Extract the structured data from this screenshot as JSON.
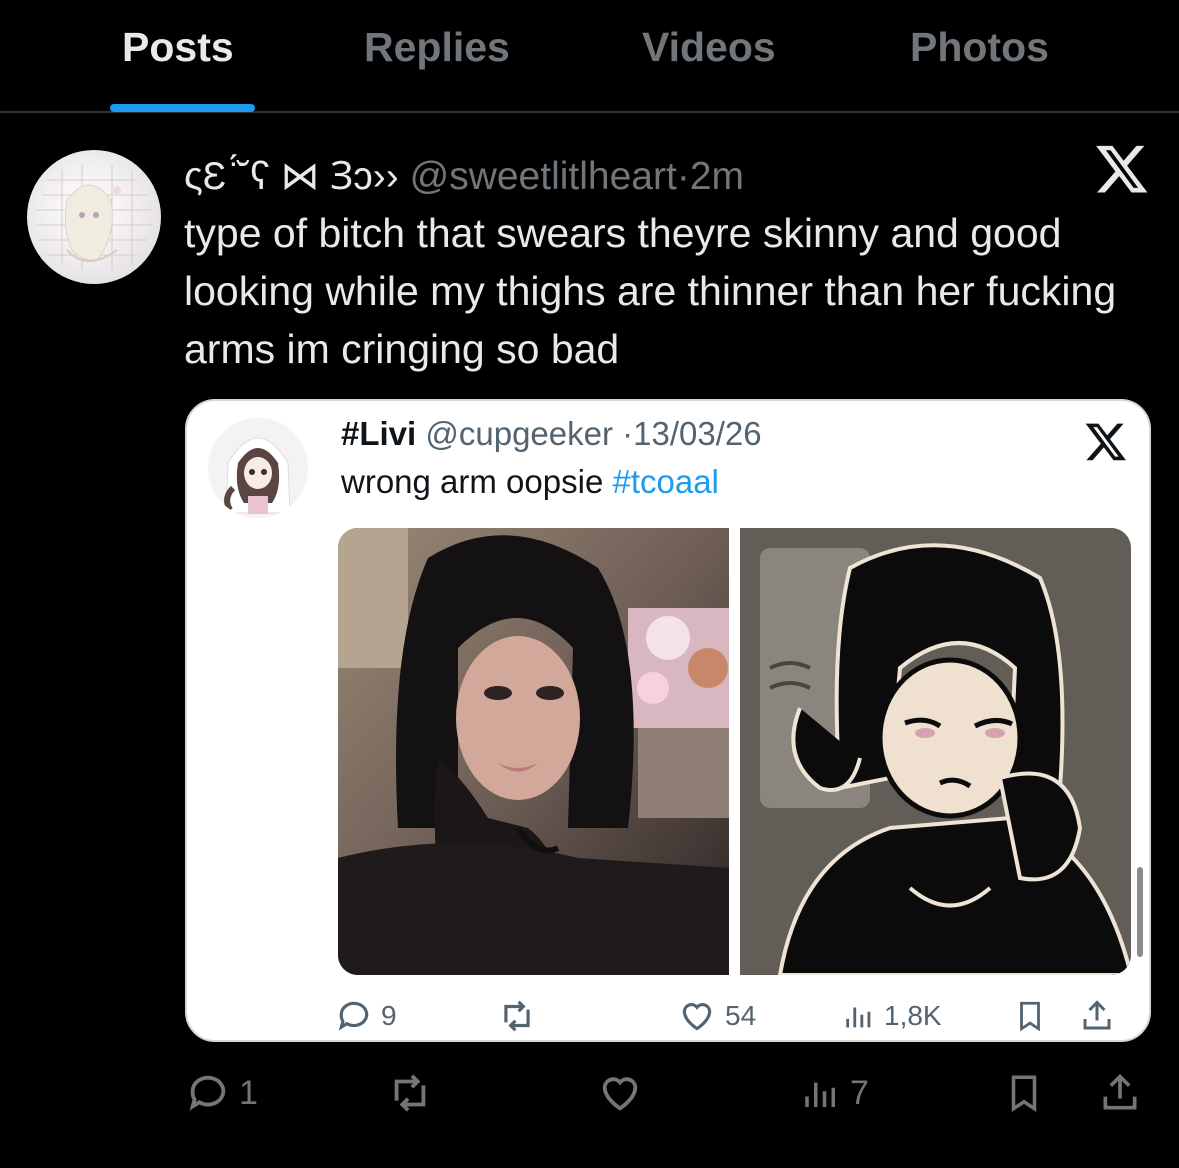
{
  "tabs": [
    {
      "label": "Posts",
      "active": true
    },
    {
      "label": "Replies",
      "active": false
    },
    {
      "label": "Videos",
      "active": false
    },
    {
      "label": "Photos",
      "active": false
    }
  ],
  "colors": {
    "accent": "#1d9bf0",
    "background": "#000000",
    "muted": "#71767b",
    "hashtag": "#1d9bf0"
  },
  "post": {
    "display_name": "ςƐ ̈́˘ʕ ⋈ Ɜɔ››",
    "handle": "@sweetlitlheart",
    "separator": "·",
    "time": "2m",
    "logo_icon": "x-logo-icon",
    "text": "type of bitch that swears theyre skinny and good looking while my thighs are thinner than her fucking arms im cringing so bad",
    "actions": {
      "replies": "1",
      "reposts": "",
      "likes": "",
      "views": "7"
    }
  },
  "quote": {
    "display_name": "#Livi",
    "handle": "@cupgeeker",
    "separator": "·",
    "date": "13/03/26",
    "logo_icon": "x-logo-icon",
    "text": "wrong arm oopsie",
    "hashtag": "#tcoaal",
    "images": [
      "selfie-photo",
      "cartoon-drawing"
    ],
    "actions": {
      "replies": "9",
      "likes": "54",
      "views": "1,8K"
    }
  }
}
